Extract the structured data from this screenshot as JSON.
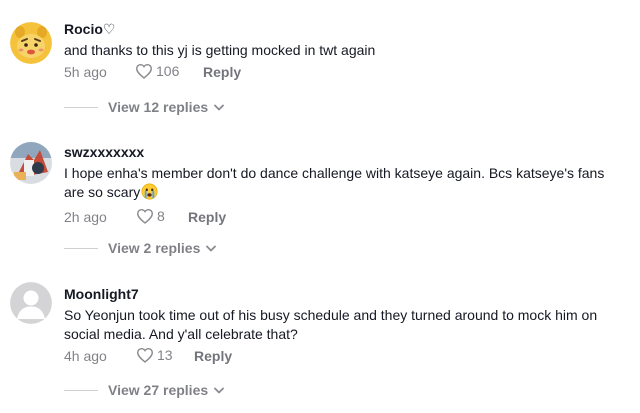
{
  "comments": [
    {
      "username": "Rocio♡",
      "text": "and thanks to this yj is getting mocked in twt again",
      "time": "5h ago",
      "likes": "106",
      "reply_label": "Reply",
      "view_replies": "View 12 replies",
      "avatar": "cartoon-bear-avatar"
    },
    {
      "username": "swzxxxxxxx",
      "text": "I hope enha's member don't do dance challenge with katseye again. Bcs katseye's fans are so scary",
      "emoji": "crying-face-emoji",
      "time": "2h ago",
      "likes": "8",
      "reply_label": "Reply",
      "view_replies": "View 2 replies",
      "avatar": "photo-avatar"
    },
    {
      "username": "Moonlight7",
      "text": "So Yeonjun took time out of his busy schedule and they turned around to mock him on social media. And y'all celebrate that?",
      "time": "4h ago",
      "likes": "13",
      "reply_label": "Reply",
      "view_replies": "View 27 replies",
      "avatar": "default-avatar"
    }
  ],
  "colors": {
    "text": "#161823",
    "muted": "#8a8b91",
    "divider": "#d0d0d4"
  }
}
